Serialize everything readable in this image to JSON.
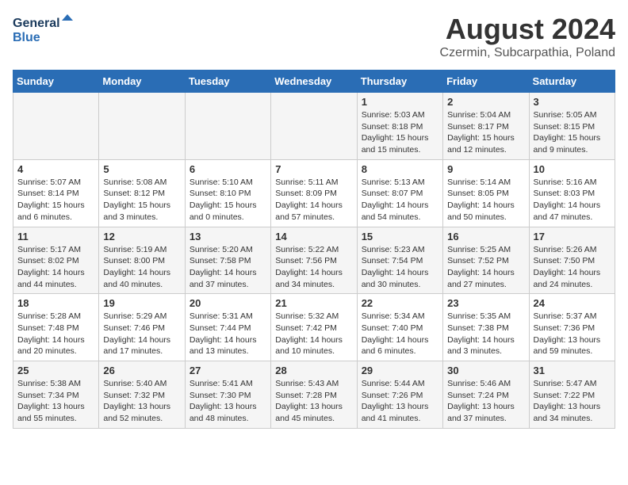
{
  "logo": {
    "line1": "General",
    "line2": "Blue"
  },
  "title": "August 2024",
  "subtitle": "Czermin, Subcarpathia, Poland",
  "days_of_week": [
    "Sunday",
    "Monday",
    "Tuesday",
    "Wednesday",
    "Thursday",
    "Friday",
    "Saturday"
  ],
  "weeks": [
    [
      {
        "num": "",
        "info": ""
      },
      {
        "num": "",
        "info": ""
      },
      {
        "num": "",
        "info": ""
      },
      {
        "num": "",
        "info": ""
      },
      {
        "num": "1",
        "info": "Sunrise: 5:03 AM\nSunset: 8:18 PM\nDaylight: 15 hours\nand 15 minutes."
      },
      {
        "num": "2",
        "info": "Sunrise: 5:04 AM\nSunset: 8:17 PM\nDaylight: 15 hours\nand 12 minutes."
      },
      {
        "num": "3",
        "info": "Sunrise: 5:05 AM\nSunset: 8:15 PM\nDaylight: 15 hours\nand 9 minutes."
      }
    ],
    [
      {
        "num": "4",
        "info": "Sunrise: 5:07 AM\nSunset: 8:14 PM\nDaylight: 15 hours\nand 6 minutes."
      },
      {
        "num": "5",
        "info": "Sunrise: 5:08 AM\nSunset: 8:12 PM\nDaylight: 15 hours\nand 3 minutes."
      },
      {
        "num": "6",
        "info": "Sunrise: 5:10 AM\nSunset: 8:10 PM\nDaylight: 15 hours\nand 0 minutes."
      },
      {
        "num": "7",
        "info": "Sunrise: 5:11 AM\nSunset: 8:09 PM\nDaylight: 14 hours\nand 57 minutes."
      },
      {
        "num": "8",
        "info": "Sunrise: 5:13 AM\nSunset: 8:07 PM\nDaylight: 14 hours\nand 54 minutes."
      },
      {
        "num": "9",
        "info": "Sunrise: 5:14 AM\nSunset: 8:05 PM\nDaylight: 14 hours\nand 50 minutes."
      },
      {
        "num": "10",
        "info": "Sunrise: 5:16 AM\nSunset: 8:03 PM\nDaylight: 14 hours\nand 47 minutes."
      }
    ],
    [
      {
        "num": "11",
        "info": "Sunrise: 5:17 AM\nSunset: 8:02 PM\nDaylight: 14 hours\nand 44 minutes."
      },
      {
        "num": "12",
        "info": "Sunrise: 5:19 AM\nSunset: 8:00 PM\nDaylight: 14 hours\nand 40 minutes."
      },
      {
        "num": "13",
        "info": "Sunrise: 5:20 AM\nSunset: 7:58 PM\nDaylight: 14 hours\nand 37 minutes."
      },
      {
        "num": "14",
        "info": "Sunrise: 5:22 AM\nSunset: 7:56 PM\nDaylight: 14 hours\nand 34 minutes."
      },
      {
        "num": "15",
        "info": "Sunrise: 5:23 AM\nSunset: 7:54 PM\nDaylight: 14 hours\nand 30 minutes."
      },
      {
        "num": "16",
        "info": "Sunrise: 5:25 AM\nSunset: 7:52 PM\nDaylight: 14 hours\nand 27 minutes."
      },
      {
        "num": "17",
        "info": "Sunrise: 5:26 AM\nSunset: 7:50 PM\nDaylight: 14 hours\nand 24 minutes."
      }
    ],
    [
      {
        "num": "18",
        "info": "Sunrise: 5:28 AM\nSunset: 7:48 PM\nDaylight: 14 hours\nand 20 minutes."
      },
      {
        "num": "19",
        "info": "Sunrise: 5:29 AM\nSunset: 7:46 PM\nDaylight: 14 hours\nand 17 minutes."
      },
      {
        "num": "20",
        "info": "Sunrise: 5:31 AM\nSunset: 7:44 PM\nDaylight: 14 hours\nand 13 minutes."
      },
      {
        "num": "21",
        "info": "Sunrise: 5:32 AM\nSunset: 7:42 PM\nDaylight: 14 hours\nand 10 minutes."
      },
      {
        "num": "22",
        "info": "Sunrise: 5:34 AM\nSunset: 7:40 PM\nDaylight: 14 hours\nand 6 minutes."
      },
      {
        "num": "23",
        "info": "Sunrise: 5:35 AM\nSunset: 7:38 PM\nDaylight: 14 hours\nand 3 minutes."
      },
      {
        "num": "24",
        "info": "Sunrise: 5:37 AM\nSunset: 7:36 PM\nDaylight: 13 hours\nand 59 minutes."
      }
    ],
    [
      {
        "num": "25",
        "info": "Sunrise: 5:38 AM\nSunset: 7:34 PM\nDaylight: 13 hours\nand 55 minutes."
      },
      {
        "num": "26",
        "info": "Sunrise: 5:40 AM\nSunset: 7:32 PM\nDaylight: 13 hours\nand 52 minutes."
      },
      {
        "num": "27",
        "info": "Sunrise: 5:41 AM\nSunset: 7:30 PM\nDaylight: 13 hours\nand 48 minutes."
      },
      {
        "num": "28",
        "info": "Sunrise: 5:43 AM\nSunset: 7:28 PM\nDaylight: 13 hours\nand 45 minutes."
      },
      {
        "num": "29",
        "info": "Sunrise: 5:44 AM\nSunset: 7:26 PM\nDaylight: 13 hours\nand 41 minutes."
      },
      {
        "num": "30",
        "info": "Sunrise: 5:46 AM\nSunset: 7:24 PM\nDaylight: 13 hours\nand 37 minutes."
      },
      {
        "num": "31",
        "info": "Sunrise: 5:47 AM\nSunset: 7:22 PM\nDaylight: 13 hours\nand 34 minutes."
      }
    ]
  ]
}
